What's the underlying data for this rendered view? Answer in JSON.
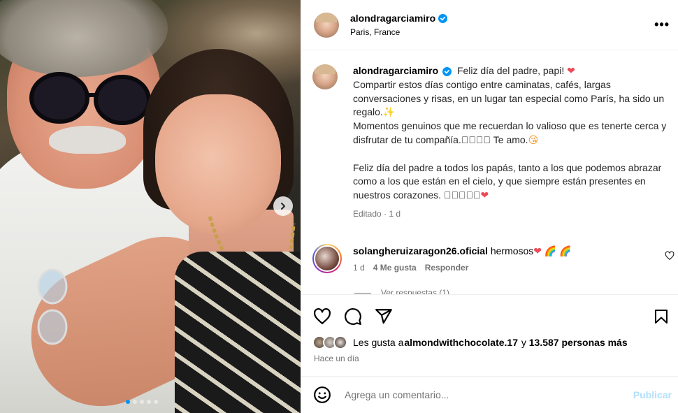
{
  "post": {
    "username": "alondragarciamiro",
    "location": "Paris, France",
    "more_icon": "more-options-icon"
  },
  "caption": {
    "username": "alondragarciamiro",
    "line1": "Feliz día del padre, papi! ",
    "line2": "Compartir estos días contigo entre caminatas, cafés, largas conversaciones y risas, en un lugar tan especial como París, ha sido un regalo.",
    "line3": "Momentos genuinos que me recuerdan lo valioso que es tenerte cerca y disfrutar de tu compañía.",
    "line3_emojis": "􀀀􀀀􀀀􀀀",
    "line3_tail": " Te amo.",
    "line4": "Feliz día del padre a todos los papás, tanto a los que podemos abrazar como a los que están en el cielo, y que siempre están presentes en nuestros corazones. ",
    "line4_emojis": "􀀀􀀀􀀀􀀀􀀀",
    "edited": "Editado",
    "edited_time": "1 d"
  },
  "comment": {
    "username": "solangheruizaragon26.oficial",
    "text": "hermosos",
    "time": "1 d",
    "likes": "4 Me gusta",
    "reply": "Responder",
    "view_replies": "Ver respuestas (1)"
  },
  "likes": {
    "prefix": "Les gusta a ",
    "user": "almondwithchocolate.17",
    "middle": " y ",
    "count": "13.587 personas más"
  },
  "time_ago": "Hace un día",
  "add_comment": {
    "placeholder": "Agrega un comentario...",
    "publish": "Publicar"
  },
  "carousel": {
    "total": 5,
    "active": 0
  },
  "colors": {
    "verified": "#0095f6",
    "heart": "#ed4956",
    "publish_disabled": "#b2dffc"
  }
}
